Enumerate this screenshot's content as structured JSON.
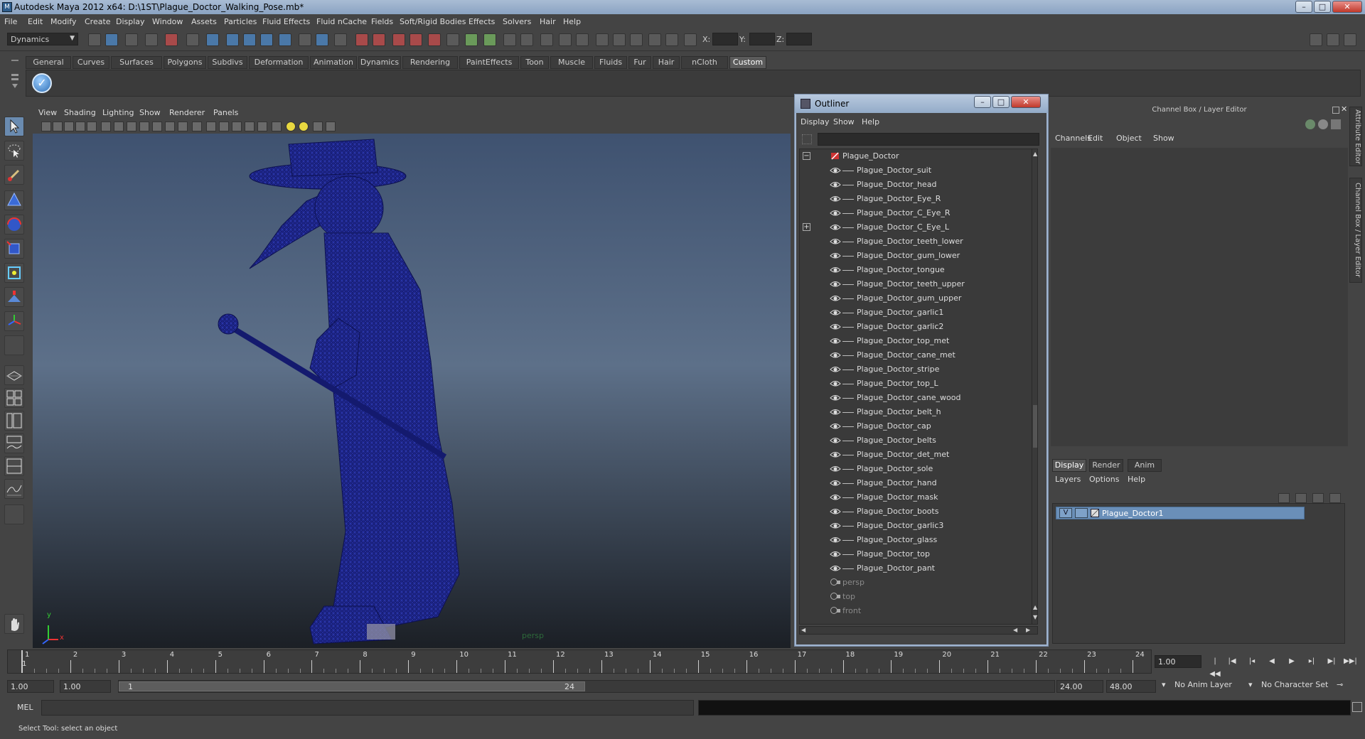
{
  "window": {
    "title": "Autodesk Maya 2012 x64: D:\\1ST\\Plague_Doctor_Walking_Pose.mb*",
    "app_icon": "maya-icon",
    "controls": [
      "minimize-icon",
      "maximize-icon",
      "close-icon"
    ]
  },
  "menubar": [
    "File",
    "Edit",
    "Modify",
    "Create",
    "Display",
    "Window",
    "Assets",
    "Particles",
    "Fluid Effects",
    "Fluid nCache",
    "Fields",
    "Soft/Rigid Bodies",
    "Effects",
    "Solvers",
    "Hair",
    "Help"
  ],
  "statusline": {
    "mode": "Dynamics",
    "x_label": "X:",
    "y_label": "Y:",
    "z_label": "Z:"
  },
  "shelf": {
    "tabs": [
      "General",
      "Curves",
      "Surfaces",
      "Polygons",
      "Subdivs",
      "Deformation",
      "Animation",
      "Dynamics",
      "Rendering",
      "PaintEffects",
      "Toon",
      "Muscle",
      "Fluids",
      "Fur",
      "Hair",
      "nCloth",
      "Custom"
    ],
    "active_tab": "Custom"
  },
  "viewport": {
    "menu": [
      "View",
      "Shading",
      "Lighting",
      "Show",
      "Renderer",
      "Panels"
    ],
    "camera_label": "persp",
    "axis_y": "y",
    "axis_x": "x",
    "wire_color": "#1a1a7a"
  },
  "outliner": {
    "title": "Outliner",
    "menu": [
      "Display",
      "Show",
      "Help"
    ],
    "root": "Plague_Doctor",
    "children": [
      "Plague_Doctor_suit",
      "Plague_Doctor_head",
      "Plague_Doctor_Eye_R",
      "Plague_Doctor_C_Eye_R",
      "Plague_Doctor_C_Eye_L",
      "Plague_Doctor_teeth_lower",
      "Plague_Doctor_gum_lower",
      "Plague_Doctor_tongue",
      "Plague_Doctor_teeth_upper",
      "Plague_Doctor_gum_upper",
      "Plague_Doctor_garlic1",
      "Plague_Doctor_garlic2",
      "Plague_Doctor_top_met",
      "Plague_Doctor_cane_met",
      "Plague_Doctor_stripe",
      "Plague_Doctor_top_L",
      "Plague_Doctor_cane_wood",
      "Plague_Doctor_belt_h",
      "Plague_Doctor_cap",
      "Plague_Doctor_belts",
      "Plague_Doctor_det_met",
      "Plague_Doctor_sole",
      "Plague_Doctor_hand",
      "Plague_Doctor_mask",
      "Plague_Doctor_boots",
      "Plague_Doctor_garlic3",
      "Plague_Doctor_glass",
      "Plague_Doctor_top",
      "Plague_Doctor_pant"
    ],
    "cameras": [
      "persp",
      "top",
      "front"
    ]
  },
  "channelbox": {
    "title": "Channel Box / Layer Editor",
    "menu": [
      "Channels",
      "Edit",
      "Object",
      "Show"
    ],
    "layer_tabs": [
      "Display",
      "Render",
      "Anim"
    ],
    "active_layer_tab": "Display",
    "layer_menu": [
      "Layers",
      "Options",
      "Help"
    ],
    "layer_visible": "V",
    "layer_name": "Plague_Doctor1",
    "side_tabs": [
      "Attribute Editor",
      "Channel Box / Layer Editor"
    ]
  },
  "timeline": {
    "start_label": "1",
    "ticks": [
      "1",
      "2",
      "3",
      "4",
      "5",
      "6",
      "7",
      "8",
      "9",
      "10",
      "11",
      "12",
      "13",
      "14",
      "15",
      "16",
      "17",
      "18",
      "19",
      "20",
      "21",
      "22",
      "23",
      "24"
    ],
    "current_frame": "1.00",
    "playback_icons": [
      "go-to-start-icon",
      "step-back-key-icon",
      "step-back-frame-icon",
      "play-back-icon",
      "play-forward-icon",
      "step-forward-frame-icon",
      "step-forward-key-icon",
      "go-to-end-icon"
    ]
  },
  "range": {
    "start": "1.00",
    "playback_start": "1.00",
    "thumb_start": "1",
    "thumb_end": "24",
    "playback_end": "24.00",
    "end": "48.00",
    "anim_layer": "No Anim Layer",
    "character_set": "No Character Set"
  },
  "cmdline": {
    "label": "MEL"
  },
  "helpline": {
    "text": "Select Tool: select an object"
  }
}
